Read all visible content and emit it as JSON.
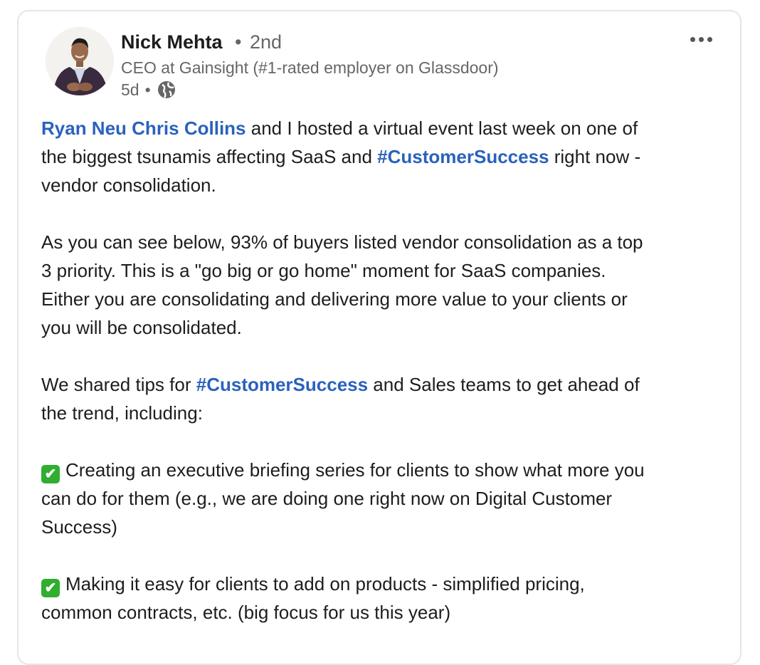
{
  "author": {
    "name": "Nick Mehta",
    "separator": "•",
    "degree": "2nd",
    "headline": "CEO at Gainsight (#1-rated employer on Glassdoor)",
    "time": "5d",
    "meta_separator": "•",
    "visibility_icon": "globe-icon"
  },
  "more_icon": "ellipsis-icon",
  "post": {
    "p1": {
      "mention1": "Ryan Neu",
      "mention2": "Chris Collins",
      "text1": " and I hosted a virtual event last week on one of",
      "text2": "the biggest tsunamis affecting SaaS and ",
      "hashtag": "#CustomerSuccess",
      "text3": " right now -",
      "text4": "vendor consolidation."
    },
    "p2": {
      "line1": "As you can see below, 93% of buyers listed vendor consolidation as a top",
      "line2": "3 priority. This is a \"go big or go home\" moment for SaaS companies.",
      "line3": "Either you are consolidating and delivering more value to your clients or",
      "line4": "you will be consolidated."
    },
    "p3": {
      "text1": "We shared tips for ",
      "hashtag": "#CustomerSuccess",
      "text2": " and Sales teams to get ahead of",
      "line2": "the trend, including:"
    },
    "p4": {
      "check": "✔",
      "line1": "Creating an executive briefing series for clients to show what more you",
      "line2": "can do for them (e.g., we are doing one right now on Digital Customer",
      "line3": "Success)"
    },
    "p5": {
      "check": "✔",
      "line1": "Making it easy for clients to add on products - simplified pricing,",
      "line2": "common contracts, etc. (big focus for us this year)"
    }
  },
  "colors": {
    "link": "#2a62bc",
    "text": "#1d1d1d",
    "muted": "#666666",
    "check_bg": "#2fae2f"
  }
}
